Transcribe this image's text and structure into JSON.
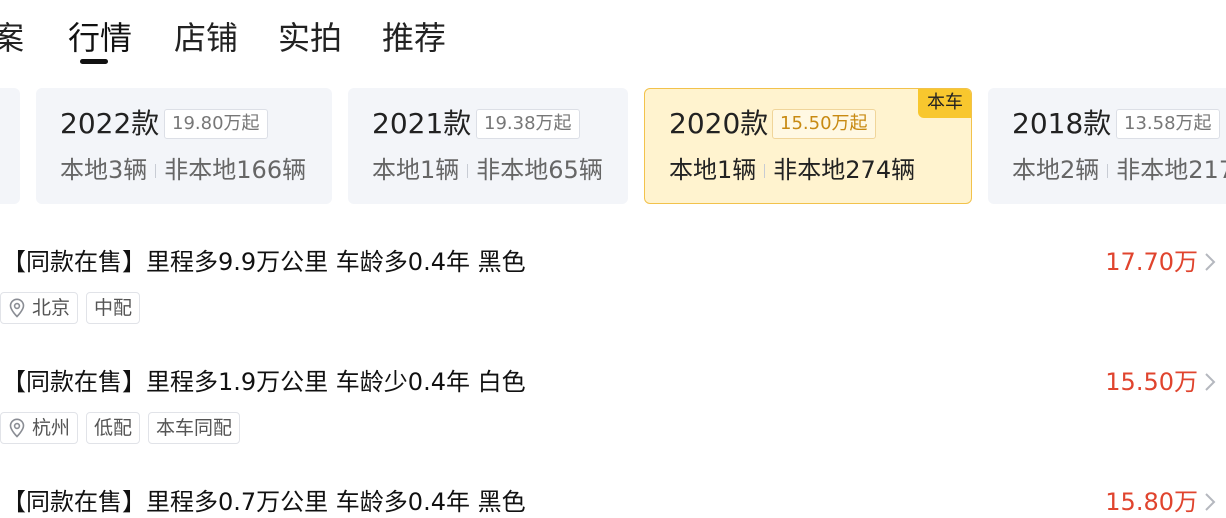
{
  "tabs": [
    {
      "label": "案",
      "active": false
    },
    {
      "label": "行情",
      "active": true
    },
    {
      "label": "店铺",
      "active": false
    },
    {
      "label": "实拍",
      "active": false
    },
    {
      "label": "推荐",
      "active": false
    }
  ],
  "year_cards": [
    {
      "year": "2022款",
      "price": "19.80万起",
      "local": "本地3辆",
      "nonlocal": "非本地166辆",
      "selected": false
    },
    {
      "year": "2021款",
      "price": "19.38万起",
      "local": "本地1辆",
      "nonlocal": "非本地65辆",
      "selected": false
    },
    {
      "year": "2020款",
      "price": "15.50万起",
      "local": "本地1辆",
      "nonlocal": "非本地274辆",
      "selected": true,
      "badge": "本车"
    },
    {
      "year": "2018款",
      "price": "13.58万起",
      "local": "本地2辆",
      "nonlocal": "非本地217",
      "selected": false
    }
  ],
  "listings": [
    {
      "title": "【同款在售】里程多9.9万公里 车龄多0.4年 黑色",
      "price": "17.70万",
      "location": "北京",
      "tags": [
        "中配"
      ]
    },
    {
      "title": "【同款在售】里程多1.9万公里 车龄少0.4年 白色",
      "price": "15.50万",
      "location": "杭州",
      "tags": [
        "低配",
        "本车同配"
      ]
    },
    {
      "title": "【同款在售】里程多0.7万公里 车龄多0.4年 黑色",
      "price": "15.80万"
    }
  ],
  "colors": {
    "price_red": "#e0442e",
    "selected_card_bg": "#fff3cf",
    "selected_card_border": "#f2c24b",
    "badge_yellow": "#f8c72e",
    "card_bg": "#f3f5f9",
    "selected_price_text": "#c88a12"
  },
  "icons": {
    "location": "location-pin-icon",
    "chevron": "chevron-right-icon"
  }
}
